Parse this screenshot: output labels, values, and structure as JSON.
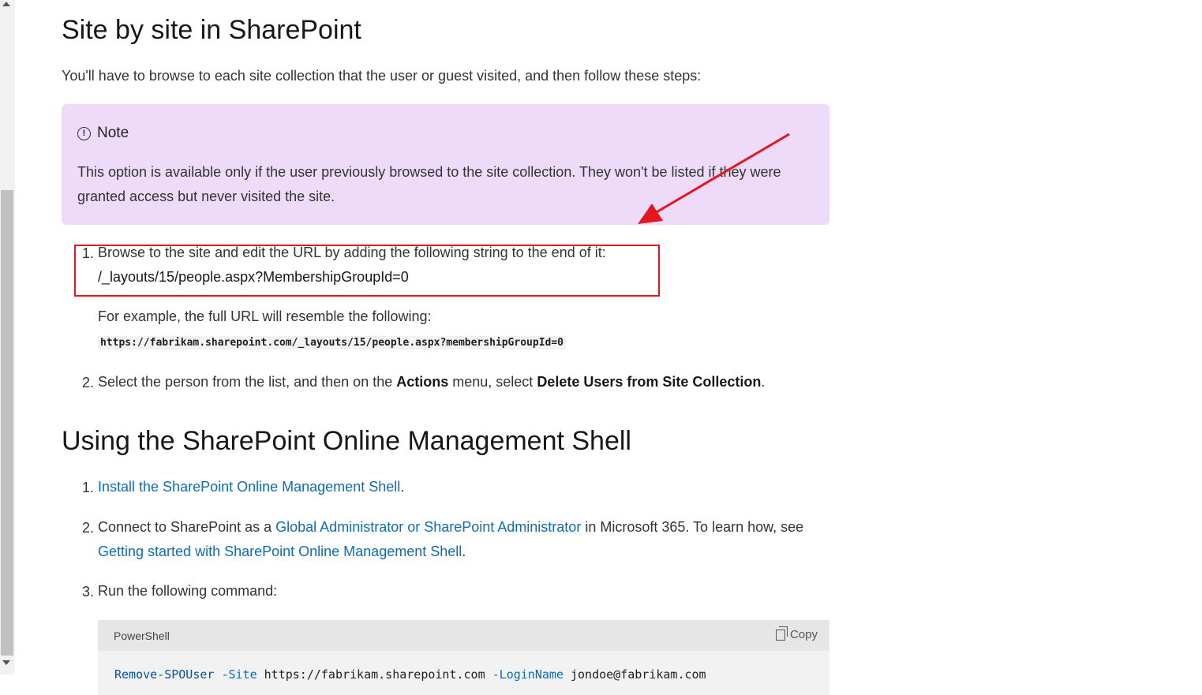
{
  "section1": {
    "title": "Site by site in SharePoint",
    "intro": "You'll have to browse to each site collection that the user or guest visited, and then follow these steps:",
    "note": {
      "heading": "Note",
      "icon": "info-icon",
      "text": "This option is available only if the user previously browsed to the site collection. They won't be listed if they were granted access but never visited the site."
    },
    "steps": [
      {
        "num": "1.",
        "text": "Browse to the site and edit the URL by adding the following string to the end of it:",
        "path": "/_layouts/15/people.aspx?MembershipGroupId=0",
        "example_label": "For example, the full URL will resemble the following:",
        "example_url": "https://fabrikam.sharepoint.com/_layouts/15/people.aspx?membershipGroupId=0"
      },
      {
        "num": "2.",
        "text_a": "Select the person from the list, and then on the ",
        "bold_a": "Actions",
        "text_b": " menu, select ",
        "bold_b": "Delete Users from Site Collection",
        "text_c": "."
      }
    ]
  },
  "section2": {
    "title": "Using the SharePoint Online Management Shell",
    "steps": [
      {
        "num": "1.",
        "link": "Install the SharePoint Online Management Shell",
        "after": "."
      },
      {
        "num": "2.",
        "before": "Connect to SharePoint as a ",
        "link_a": "Global Administrator or SharePoint Administrator",
        "middle": " in Microsoft 365. To learn how, see ",
        "link_b": "Getting started with SharePoint Online Management Shell",
        "after": "."
      },
      {
        "num": "3.",
        "text": "Run the following command:"
      }
    ],
    "code": {
      "language": "PowerShell",
      "copy_label": "Copy",
      "cmd": "Remove-SPOUser",
      "param_site": "-Site",
      "site_value": "https://fabrikam.sharepoint.com",
      "param_login": "-LoginName",
      "login_value": "jondoe@fabrikam.com"
    }
  },
  "colors": {
    "note_bg": "#eedaf9",
    "link": "#0f6cbd",
    "annotation_red": "#e8151f"
  }
}
